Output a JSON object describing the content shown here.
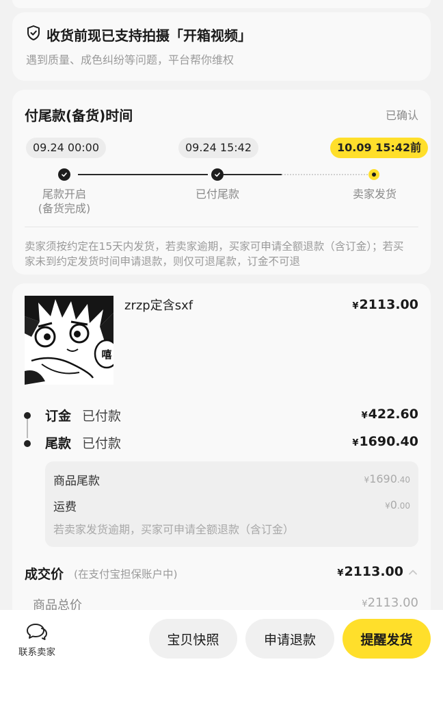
{
  "video_card": {
    "title": "收货前现已支持拍摄「开箱视频」",
    "subtitle": "遇到质量、成色纠纷等问题，平台帮你维权"
  },
  "timeline": {
    "title": "付尾款(备货)时间",
    "status": "已确认",
    "steps": [
      {
        "time": "09.24 00:00",
        "label": "尾款开启",
        "sub_label": "(备货完成)"
      },
      {
        "time": "09.24 15:42",
        "label": "已付尾款"
      },
      {
        "time": "10.09 15:42前",
        "label": "卖家发货"
      }
    ],
    "note": "卖家须按约定在15天内发货，若卖家逾期，买家可申请全额退款（含订金）；若买家未到约定发货时间申请退款，则仅可退尾款，订金不可退"
  },
  "order": {
    "product_name": "zrzp定含sxf",
    "product_price": "2113.00",
    "currency": "¥",
    "thumb_text": "嘻",
    "payments": [
      {
        "name": "订金",
        "status": "已付款",
        "amount": "422.60"
      },
      {
        "name": "尾款",
        "status": "已付款",
        "amount": "1690.40"
      }
    ],
    "details": [
      {
        "label": "商品尾款",
        "int": "1690",
        "dec": ".40"
      },
      {
        "label": "运费",
        "int": "0",
        "dec": ".00"
      }
    ],
    "detail_note": "若卖家发货逾期，买家可申请全额退款（含订金）",
    "deal_label": "成交价",
    "deal_sub": "(在支付宝担保账户中)",
    "deal_amount": "2113.00",
    "total_label": "商品总价",
    "total_amount": "2113.00"
  },
  "bottom_bar": {
    "contact_label": "联系卖家",
    "snapshot_label": "宝贝快照",
    "refund_label": "申请退款",
    "remind_label": "提醒发货"
  },
  "colors": {
    "accent_yellow": "#ffdf2b",
    "background": "#f2f2f2",
    "card": "#f9f9f9"
  }
}
